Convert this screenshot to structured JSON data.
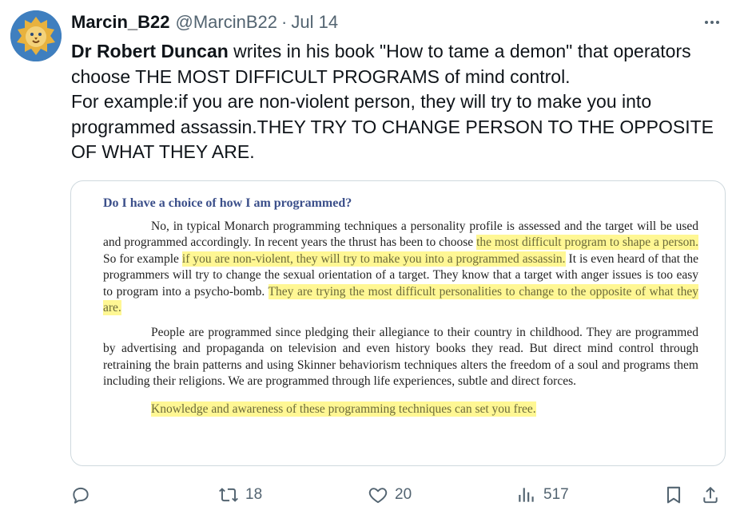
{
  "tweet": {
    "author_name": "Marcin_B22",
    "handle": "@MarcinB22",
    "separator": "·",
    "date": "Jul 14",
    "text_bold": "Dr Robert Duncan",
    "text_line1_rest": " writes in his book \"How to tame a demon\" that operators choose THE MOST DIFFICULT PROGRAMS of mind control.",
    "text_line2": "For example:if you are non-violent person, they will try to make you into programmed assassin.THEY TRY TO CHANGE PERSON TO THE OPPOSITE OF WHAT THEY ARE."
  },
  "media": {
    "heading": "Do I have a choice of how I am programmed?",
    "p1_a": "No, in typical Monarch programming techniques a personality profile is assessed and the target will be used and programmed accordingly. In recent years the thrust has been to choose ",
    "p1_hl1": "the most difficult program to shape a person.",
    "p1_b": " So for example ",
    "p1_hl2": "if you are non-violent, they will try to make you into a programmed assassin.",
    "p1_c": " It is even heard of that the programmers will try to change the sexual orientation of a target. They know that a target with anger issues is too easy to program into a psycho-bomb. ",
    "p1_hl3": "They are trying the most difficult personalities to change to the opposite of what they are.",
    "p2": "People are programmed since pledging their allegiance to their country in childhood. They are programmed by advertising and propaganda on television and even history books they read. But direct mind control through retraining the brain patterns and using Skinner behaviorism techniques alters the freedom of a soul and programs them including their religions. We are programmed through life experiences, subtle and direct forces.",
    "p3": "Knowledge and awareness of these programming techniques can set you free."
  },
  "actions": {
    "reply_icon": "reply-icon",
    "retweet_count": "18",
    "like_count": "20",
    "views_count": "517"
  },
  "colors": {
    "text": "#0f1419",
    "secondary": "#536471",
    "border": "#cfd9de",
    "highlight": "#fff03c"
  }
}
